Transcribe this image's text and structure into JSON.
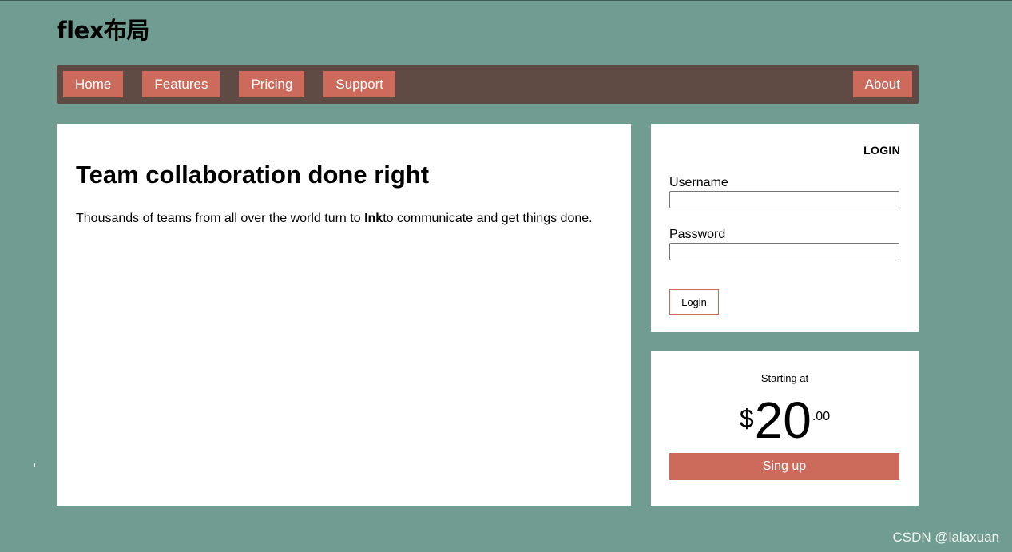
{
  "header": {
    "title": "flex布局"
  },
  "nav": {
    "items": [
      {
        "label": "Home"
      },
      {
        "label": "Features"
      },
      {
        "label": "Pricing"
      },
      {
        "label": "Support"
      },
      {
        "label": "About"
      }
    ]
  },
  "main": {
    "heading": "Team collaboration done right",
    "text_before": "Thousands of teams from all over the world turn to ",
    "brand": "Ink",
    "text_after": "to communicate and get things done."
  },
  "login": {
    "heading": "LOGIN",
    "username_label": "Username",
    "username_value": "",
    "password_label": "Password",
    "password_value": "",
    "button_label": "Login"
  },
  "pricing": {
    "starting_label": "Starting at",
    "currency": "$",
    "amount": "20",
    "cents": ".00",
    "signup_label": "Sing up"
  },
  "watermark": "CSDN @lalaxuan",
  "colors": {
    "background": "#709c91",
    "navbar": "#604a44",
    "accent": "#cc6b5b",
    "card": "#ffffff"
  }
}
